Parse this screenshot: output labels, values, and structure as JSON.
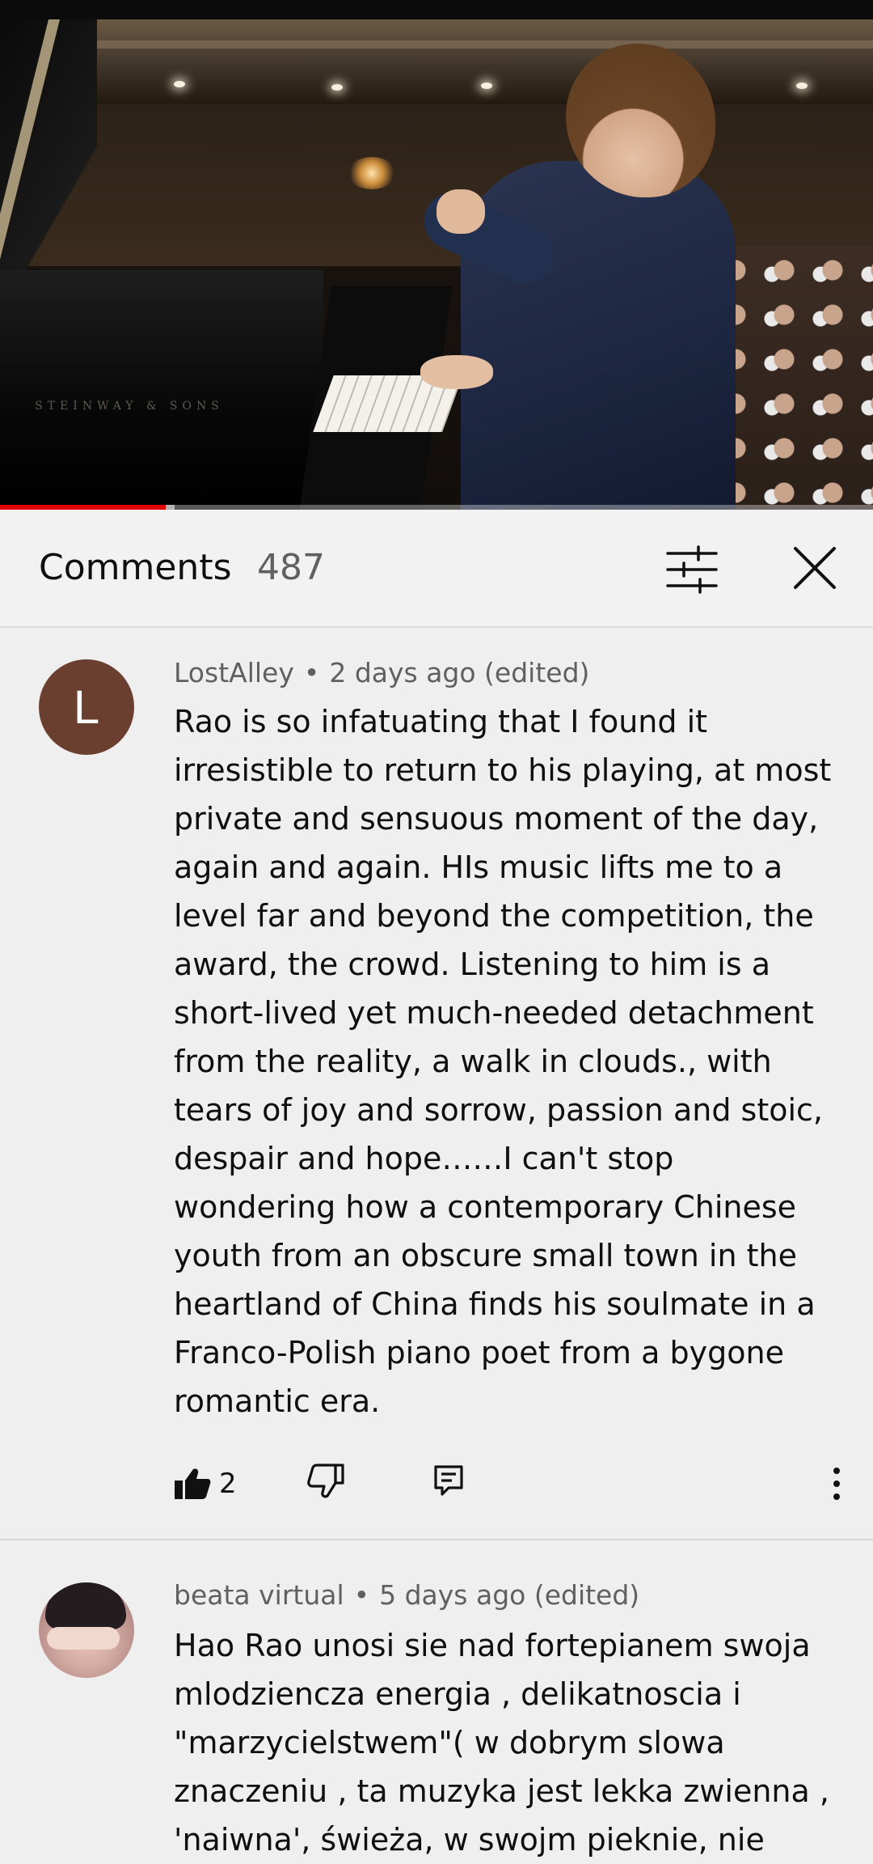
{
  "video": {
    "progress_fraction": 0.19,
    "buffered_fraction": 0.2,
    "piano_brand": "STEINWAY & SONS",
    "accent_color": "#e00000"
  },
  "comments_header": {
    "title": "Comments",
    "count": "487",
    "filter_icon": "sort-filter-icon",
    "close_icon": "close-icon"
  },
  "comments": [
    {
      "avatar_letter": "L",
      "avatar_color": "#6b3f2f",
      "author": "LostAlley",
      "separator": "•",
      "time": "2 days ago (edited)",
      "text": "Rao is so infatuating that I found it\nirresistible to return to his playing,  at most\nprivate and sensuous moment of the day,\nagain and again. HIs music lifts me to a\nlevel far and beyond the competition, the\naward, the crowd. Listening to him is a\nshort-lived yet much-needed detachment\nfrom the reality, a walk in clouds., with\ntears of joy and sorrow, passion and stoic,\ndespair and hope……I can't stop\nwondering how a contemporary Chinese\nyouth from an obscure small town in the\nheartland of China finds his soulmate in a\nFranco-Polish piano poet from a bygone\nromantic era.",
      "likes": "2"
    },
    {
      "author": "beata virtual",
      "separator": "•",
      "time": "5 days ago (edited)",
      "text": "Hao Rao unosi sie nad fortepianem  swoja\nmlodziencza energia , delikatnoscia i\n\"marzycielstwem\"( w dobrym slowa\nznaczeniu  , ta muzyka jest lekka zwienna ,\n'naiwna', świeża, w swojm pieknie, nie"
    }
  ]
}
